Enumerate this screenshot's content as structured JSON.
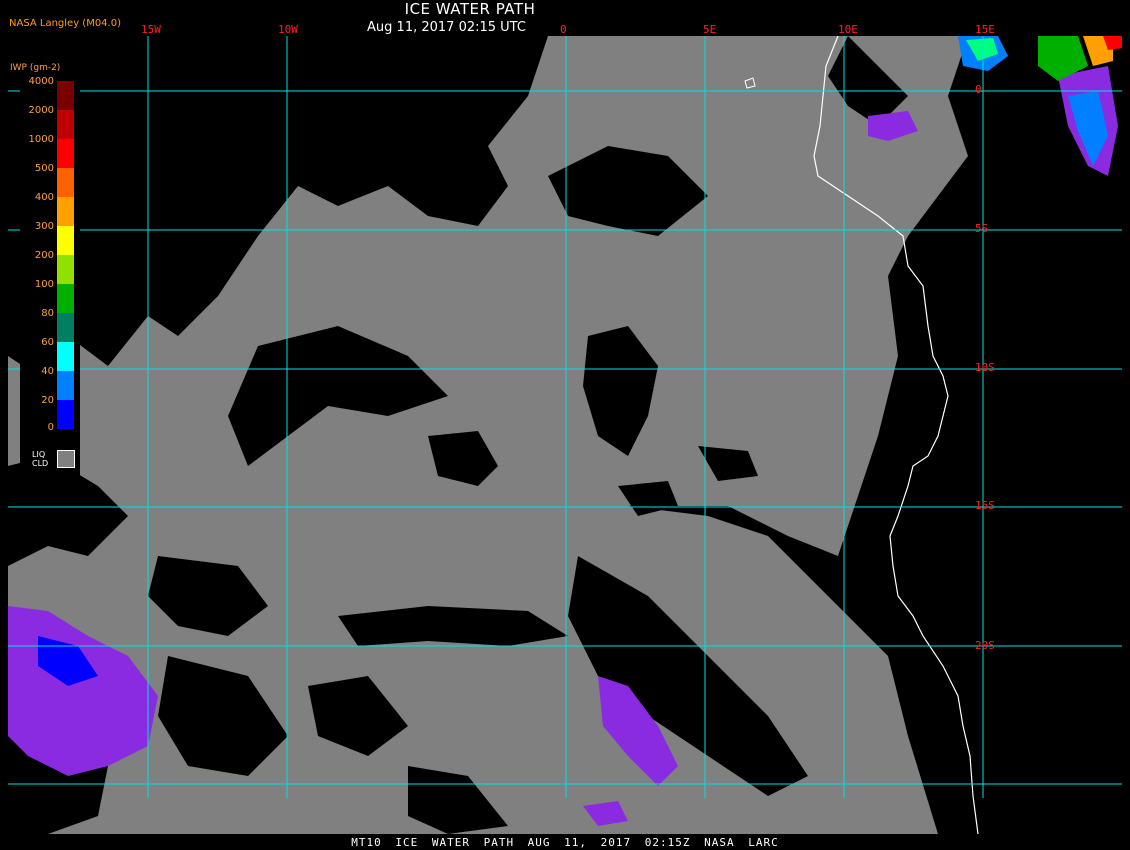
{
  "header": {
    "title": "ICE WATER PATH",
    "subtitle": "Aug 11, 2017 02:15 UTC",
    "credit": "NASA Langley (M04.0)"
  },
  "footer": {
    "text": "MT10  ICE WATER PATH  AUG 11, 2017 02:15Z  NASA LARC"
  },
  "grid": {
    "lon_labels": [
      "15W",
      "10W",
      "0",
      "5E",
      "10E",
      "15E"
    ],
    "lat_labels": [
      "0",
      "5S",
      "10S",
      "15S",
      "20S"
    ],
    "line_color": "#00e0e0",
    "label_color": "#ff2020"
  },
  "legend": {
    "title": "IWP (gm-2)",
    "ticks": [
      "4000",
      "2000",
      "1000",
      "500",
      "400",
      "300",
      "200",
      "100",
      "80",
      "60",
      "40",
      "20",
      "0"
    ],
    "colors": [
      "#7a0000",
      "#c00000",
      "#ff0000",
      "#ff6000",
      "#ffa000",
      "#ffff00",
      "#90e000",
      "#00b000",
      "#008060",
      "#00ffff",
      "#0080ff",
      "#0000ff",
      "#8a2be2"
    ],
    "liq_label": "LIQ CLD",
    "liq_color": "#808080"
  },
  "colors": {
    "background": "#000000",
    "cloud_gray": "#808080",
    "coastline": "#ffffff",
    "ice_purple": "#8a2be2"
  }
}
